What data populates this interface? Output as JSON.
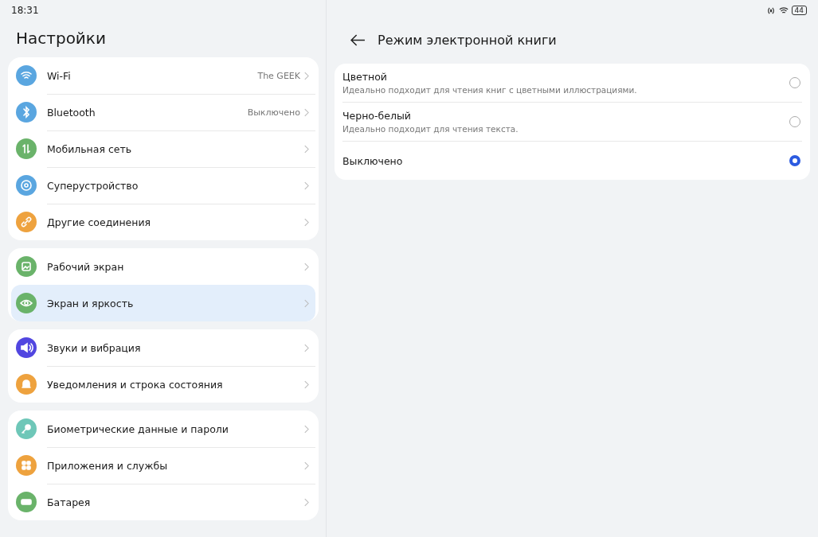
{
  "status_bar": {
    "time": "18:31",
    "battery": "44"
  },
  "sidebar": {
    "title": "Настройки",
    "groups": [
      {
        "items": [
          {
            "label": "Wi-Fi",
            "value": "The GEEK",
            "color": "#5aa6e0",
            "selected": false
          },
          {
            "label": "Bluetooth",
            "value": "Выключено",
            "color": "#5aa6e0",
            "selected": false
          },
          {
            "label": "Мобильная сеть",
            "color": "#6ab36a",
            "selected": false
          },
          {
            "label": "Суперустройство",
            "color": "#5aa6e0",
            "selected": false
          },
          {
            "label": "Другие соединения",
            "color": "#eea23e",
            "selected": false
          }
        ]
      },
      {
        "items": [
          {
            "label": "Рабочий экран",
            "color": "#6ab36a",
            "selected": false
          },
          {
            "label": "Экран и яркость",
            "color": "#6ab36a",
            "selected": true
          }
        ]
      },
      {
        "items": [
          {
            "label": "Звуки и вибрация",
            "color": "#5146e0",
            "selected": false
          },
          {
            "label": "Уведомления и строка состояния",
            "color": "#eea23e",
            "selected": false
          }
        ]
      },
      {
        "items": [
          {
            "label": "Биометрические данные и пароли",
            "color": "#6ec7b8",
            "selected": false
          },
          {
            "label": "Приложения и службы",
            "color": "#eea23e",
            "selected": false
          },
          {
            "label": "Батарея",
            "color": "#6ab36a",
            "selected": false
          }
        ]
      }
    ]
  },
  "detail": {
    "title": "Режим электронной книги",
    "options": [
      {
        "label": "Цветной",
        "description": "Идеально подходит для чтения книг с цветными иллюстрациями.",
        "selected": false
      },
      {
        "label": "Черно-белый",
        "description": "Идеально подходит для чтения текста.",
        "selected": false
      },
      {
        "label": "Выключено",
        "selected": true
      }
    ]
  }
}
